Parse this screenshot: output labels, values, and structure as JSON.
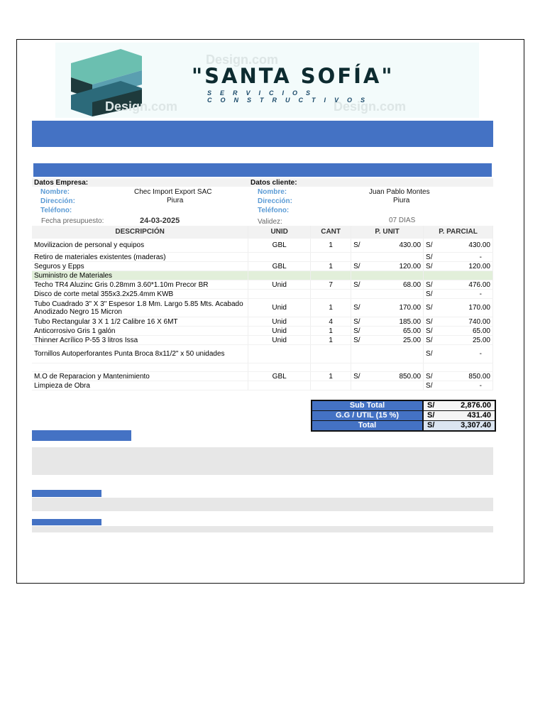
{
  "logo": {
    "brand": "\"SANTA SOFÍA\"",
    "tagline": "SERVICIOS CONSTRUCTIVOS",
    "watermark": "Design.com"
  },
  "empresa": {
    "heading": "Datos Empresa:",
    "nombre_label": "Nombre:",
    "nombre": "Chec Import Export SAC",
    "direccion_label": "Dirección:",
    "direccion": "Piura",
    "telefono_label": "Teléfono:"
  },
  "cliente": {
    "heading": "Datos cliente:",
    "nombre_label": "Nombre:",
    "nombre": "Juan Pablo Montes",
    "direccion_label": "Dirección:",
    "direccion": "Piura",
    "telefono_label": "Teléfono:"
  },
  "fecha": {
    "label": "Fecha presupuesto:",
    "value": "24-03-2025",
    "validez_label": "Validez:",
    "validez": "07 DIAS"
  },
  "columns": [
    "DESCRIPCIÓN",
    "UNID",
    "CANT",
    "P. UNIT",
    "P. PARCIAL"
  ],
  "currency": "S/",
  "rows": [
    {
      "desc": "Movilizacion de personal y equipos",
      "unid": "GBL",
      "cant": "1",
      "punit": "430.00",
      "parcial": "430.00"
    },
    {
      "desc": "Retiro de materiales existentes (maderas)",
      "unid": "",
      "cant": "",
      "punit": "",
      "parcial": "-"
    },
    {
      "desc": "Seguros y Epps",
      "unid": "GBL",
      "cant": "1",
      "punit": "120.00",
      "parcial": "120.00"
    },
    {
      "desc": "Suministro de Materiales",
      "section": true
    },
    {
      "desc": "Techo TR4 Aluzinc Gris 0.28mm 3.60*1.10m Precor BR",
      "unid": "Unid",
      "cant": "7",
      "punit": "68.00",
      "parcial": "476.00"
    },
    {
      "desc": "Disco de corte metal 355x3.2x25.4mm KWB",
      "unid": "",
      "cant": "",
      "punit": "",
      "parcial": "-"
    },
    {
      "desc": "Tubo Cuadrado 3\" X 3\" Espesor 1.8 Mm. Largo 5.85 Mts. Acabado Anodizado Negro 15 Micron",
      "unid": "Unid",
      "cant": "1",
      "punit": "170.00",
      "parcial": "170.00",
      "tall": true
    },
    {
      "desc": "Tubo Rectangular 3 X 1 1/2 Calibre 16 X 6MT",
      "unid": "Unid",
      "cant": "4",
      "punit": "185.00",
      "parcial": "740.00"
    },
    {
      "desc": "Anticorrosivo Gris 1 galón",
      "unid": "Unid",
      "cant": "1",
      "punit": "65.00",
      "parcial": "65.00"
    },
    {
      "desc": "Thinner Acrílico P-55 3 litros Issa",
      "unid": "Unid",
      "cant": "1",
      "punit": "25.00",
      "parcial": "25.00"
    },
    {
      "desc": "Tornillos Autoperforantes Punta Broca 8x11/2\" x 50 unidades",
      "unid": "",
      "cant": "",
      "punit": "",
      "parcial": "-",
      "tall": true
    },
    {
      "desc": "",
      "unid": "",
      "cant": "",
      "punit": "",
      "parcial": "",
      "blank": true
    },
    {
      "desc": "M.O de Reparacion y Mantenimiento",
      "unid": "GBL",
      "cant": "1",
      "punit": "850.00",
      "parcial": "850.00"
    },
    {
      "desc": "Limpieza de Obra",
      "unid": "",
      "cant": "",
      "punit": "",
      "parcial": "-"
    }
  ],
  "totals": [
    {
      "label": "Sub Total",
      "value": "2,876.00"
    },
    {
      "label": "G.G / UTIL (15 %)",
      "value": "431.40"
    },
    {
      "label": "Total",
      "value": "3,307.40"
    }
  ],
  "colors": {
    "accent": "#4472c4",
    "section": "#e2efda"
  }
}
